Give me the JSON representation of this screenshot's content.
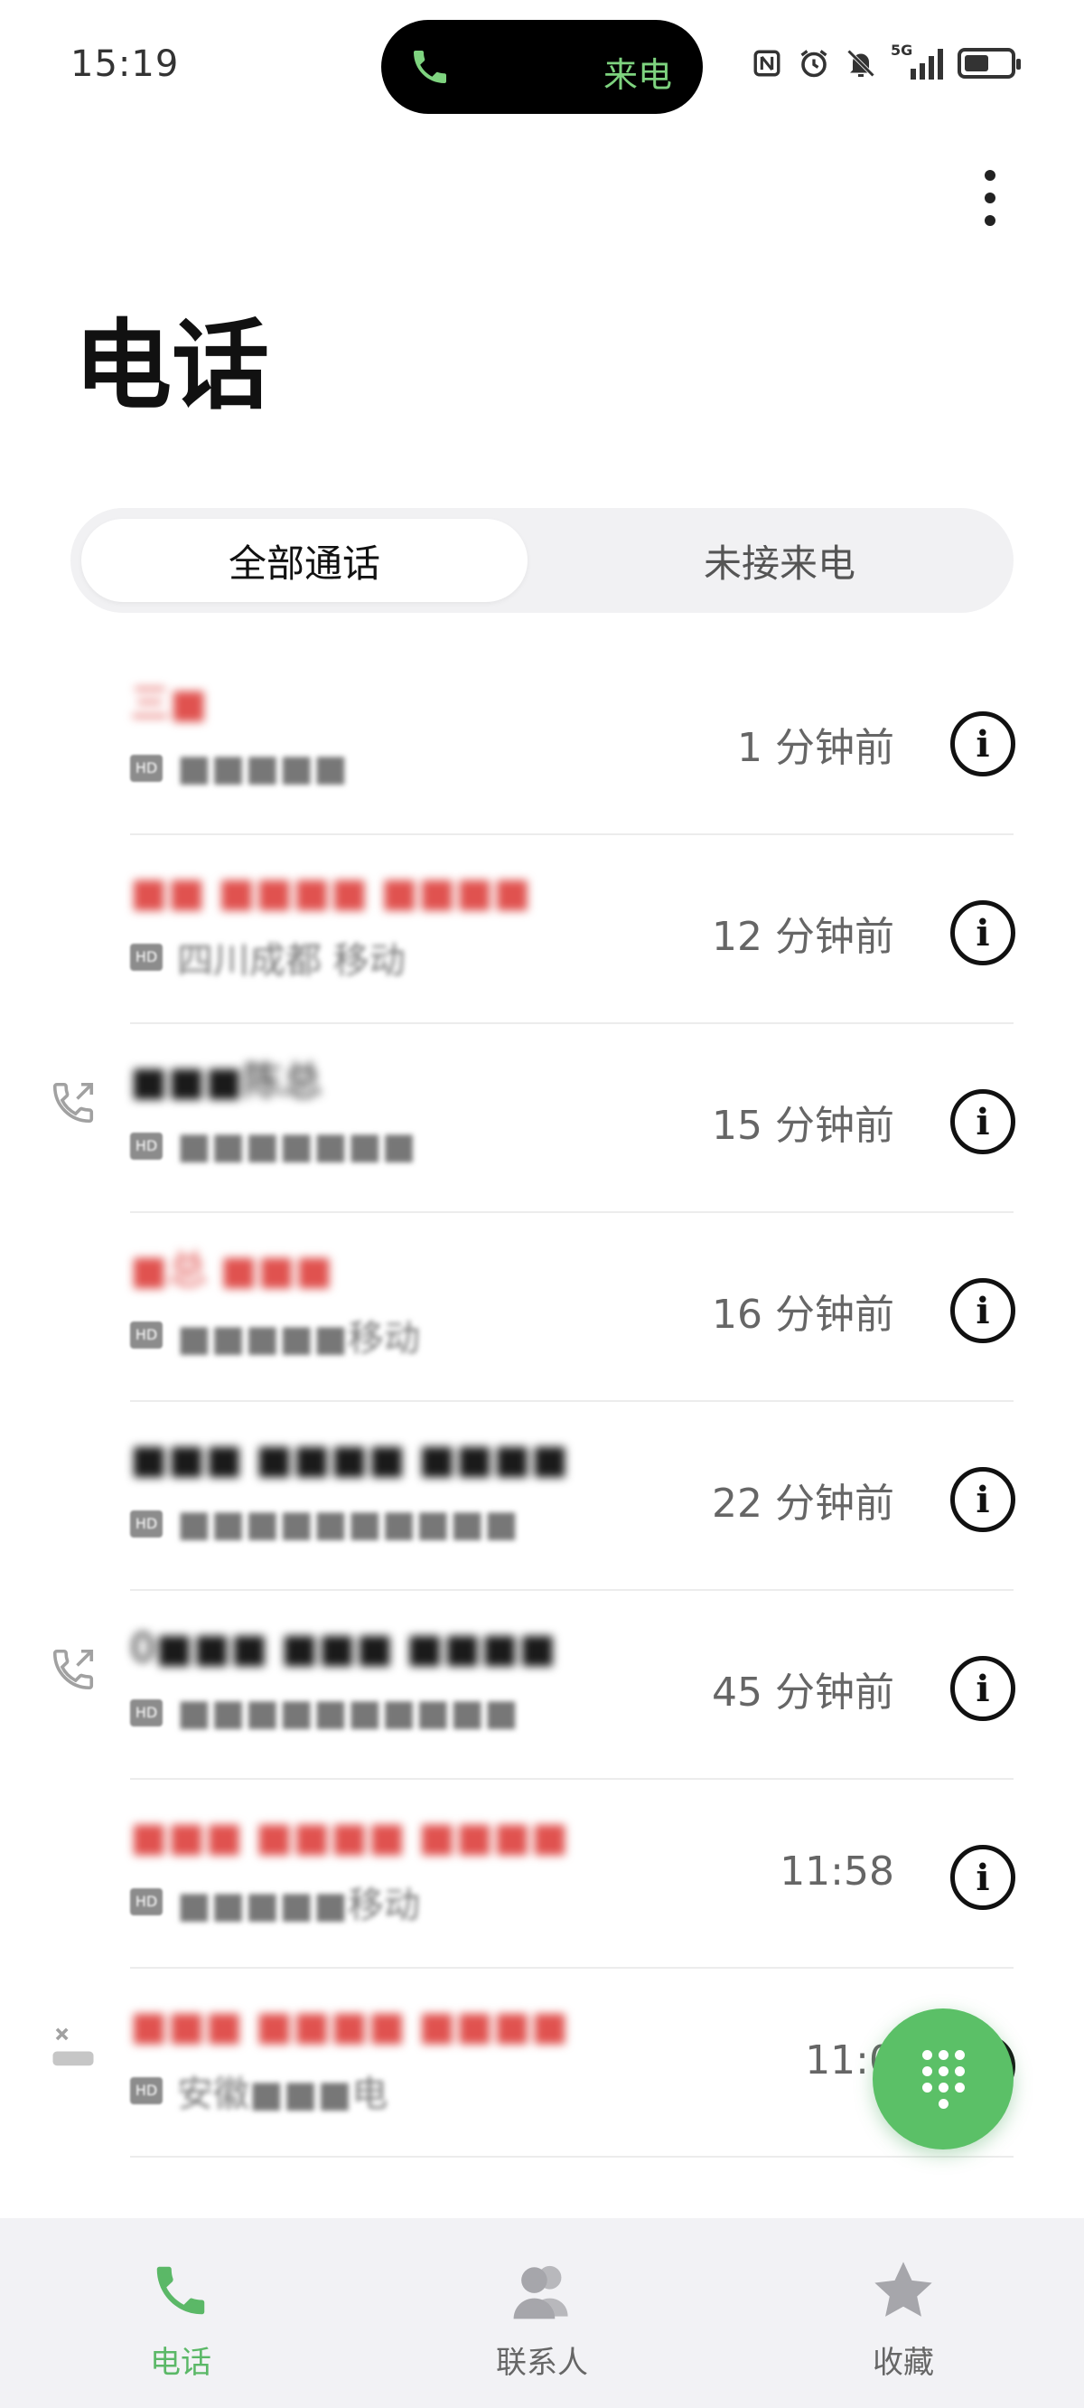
{
  "status_bar": {
    "time": "15:19",
    "call_pill_label": "来电",
    "network": "5G"
  },
  "page": {
    "title": "电话"
  },
  "tabs": [
    {
      "label": "全部通话",
      "active": true
    },
    {
      "label": "未接来电",
      "active": false
    }
  ],
  "calls": [
    {
      "name": "三■",
      "missed": true,
      "location": "■■■■■",
      "time": "1 分钟前",
      "icon": ""
    },
    {
      "name": "■■ ■■■■ ■■■■",
      "missed": true,
      "location": "四川成都 移动",
      "time": "12 分钟前",
      "icon": ""
    },
    {
      "name": "■■■陈总",
      "missed": false,
      "location": "■■■■■■■",
      "time": "15 分钟前",
      "icon": "outgoing-call-icon"
    },
    {
      "name": "■总 ■■■",
      "missed": true,
      "location": "■■■■■移动",
      "time": "16 分钟前",
      "icon": ""
    },
    {
      "name": "■■■ ■■■■ ■■■■",
      "missed": false,
      "location": "■■■■■■■■■■",
      "time": "22 分钟前",
      "icon": ""
    },
    {
      "name": "0■■■ ■■■ ■■■■",
      "missed": false,
      "location": "■■■■■■■■■■",
      "time": "45 分钟前",
      "icon": "outgoing-call-icon"
    },
    {
      "name": "■■■ ■■■■ ■■■■",
      "missed": true,
      "location": "■■■■■移动",
      "time": "11:58",
      "icon": ""
    },
    {
      "name": "■■■ ■■■■ ■■■■",
      "missed": true,
      "location": "安徽■■■电",
      "time": "11:0",
      "icon": "rejected-call-icon"
    }
  ],
  "bottom_nav": [
    {
      "label": "电话",
      "icon": "phone-icon",
      "active": true
    },
    {
      "label": "联系人",
      "icon": "contacts-icon",
      "active": false
    },
    {
      "label": "收藏",
      "icon": "star-icon",
      "active": false
    }
  ],
  "colors": {
    "accent": "#5bc067",
    "missed": "#e0524f",
    "nav_bg": "#f2f2f5"
  }
}
